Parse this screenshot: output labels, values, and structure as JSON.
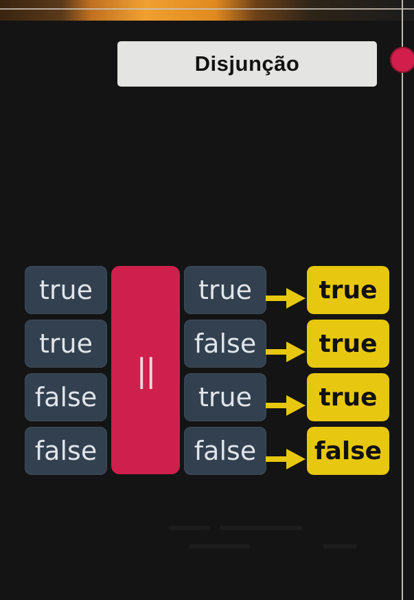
{
  "title": "Disjunção",
  "operator": "||",
  "rows": [
    {
      "a": "true",
      "b": "true",
      "result": "true"
    },
    {
      "a": "true",
      "b": "false",
      "result": "true"
    },
    {
      "a": "false",
      "b": "true",
      "result": "true"
    },
    {
      "a": "false",
      "b": "false",
      "result": "false"
    }
  ],
  "colors": {
    "background": "#141414",
    "operand_box": "#33404f",
    "operator_box": "#cf1f4c",
    "result_box": "#e8c710",
    "arrow": "#e8c710",
    "title_box": "#e4e4e2"
  }
}
